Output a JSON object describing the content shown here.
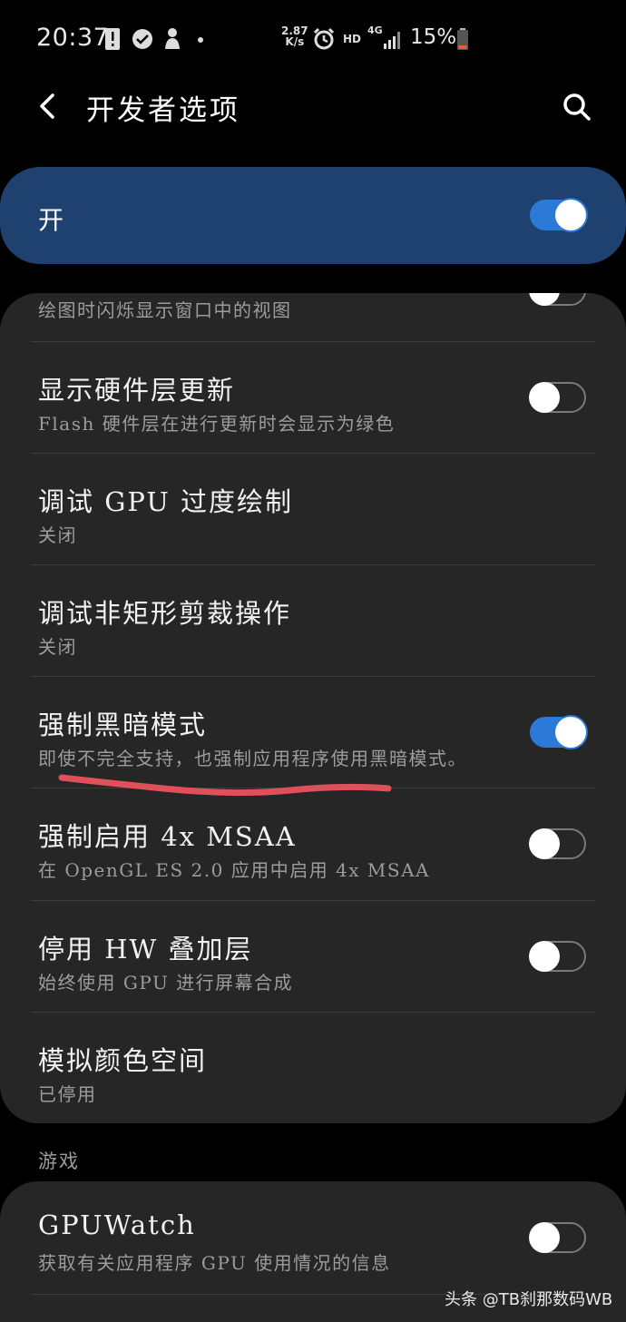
{
  "status_bar": {
    "time": "20:37",
    "speed_value": "2.87",
    "speed_unit": "K/s",
    "hd_label": "HD",
    "network_label": "4G",
    "battery_percent": "15%",
    "icons": [
      "alert-icon",
      "check-badge-icon",
      "person-icon",
      "dot-icon",
      "alarm-icon",
      "signal-icon",
      "battery-icon"
    ]
  },
  "header": {
    "title": "开发者选项",
    "back_icon": "back-arrow-icon",
    "search_icon": "search-icon"
  },
  "master_switch": {
    "label": "开",
    "state": true,
    "color": "#1e4170"
  },
  "settings": [
    {
      "title": "",
      "subtitle": "绘图时闪烁显示窗口中的视图",
      "toggle": "off"
    },
    {
      "title": "显示硬件层更新",
      "subtitle": "Flash 硬件层在进行更新时会显示为绿色",
      "toggle": "off"
    },
    {
      "title": "调试 GPU 过度绘制",
      "subtitle": "关闭",
      "toggle": null
    },
    {
      "title": "调试非矩形剪裁操作",
      "subtitle": "关闭",
      "toggle": null
    },
    {
      "title": "强制黑暗模式",
      "subtitle": "即使不完全支持，也强制应用程序使用黑暗模式。",
      "toggle": "on"
    },
    {
      "title": "强制启用 4x MSAA",
      "subtitle": "在 OpenGL ES 2.0 应用中启用 4x MSAA",
      "toggle": "off"
    },
    {
      "title": "停用 HW 叠加层",
      "subtitle": "始终使用 GPU 进行屏幕合成",
      "toggle": "off"
    },
    {
      "title": "模拟颜色空间",
      "subtitle": "已停用",
      "toggle": null
    }
  ],
  "games_section": {
    "header": "游戏",
    "items": [
      {
        "title": "GPUWatch",
        "subtitle": "获取有关应用程序 GPU 使用情况的信息",
        "toggle": "off"
      }
    ]
  },
  "colors": {
    "accent": "#2b7ad7",
    "card": "#262626",
    "annotation": "#e0505a"
  },
  "watermark": "头条 @TB刹那数码WB"
}
